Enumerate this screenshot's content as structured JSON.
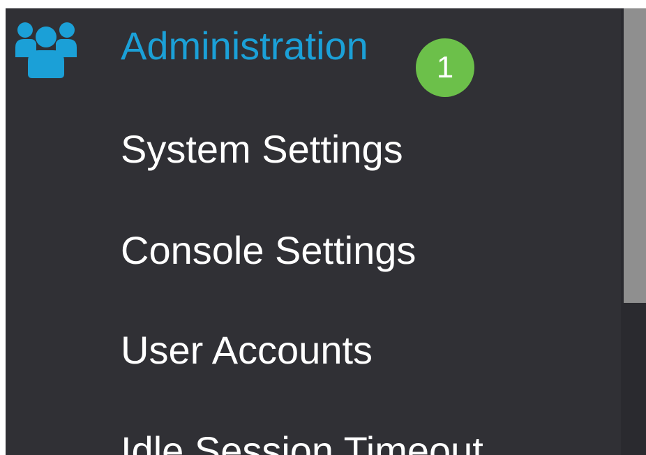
{
  "menu": {
    "section": {
      "label": "Administration",
      "icon": "users-icon",
      "icon_color": "#1ba0d7",
      "label_color": "#1ba0d7",
      "step_badge": "1",
      "badge_color": "#6cc04a"
    },
    "items": [
      {
        "label": "System Settings"
      },
      {
        "label": "Console Settings"
      },
      {
        "label": "User Accounts"
      },
      {
        "label": "Idle Session Timeout"
      }
    ]
  },
  "colors": {
    "sidebar_bg": "#303035",
    "item_text": "#ffffff",
    "scrollbar_thumb": "#8f8f8f"
  }
}
